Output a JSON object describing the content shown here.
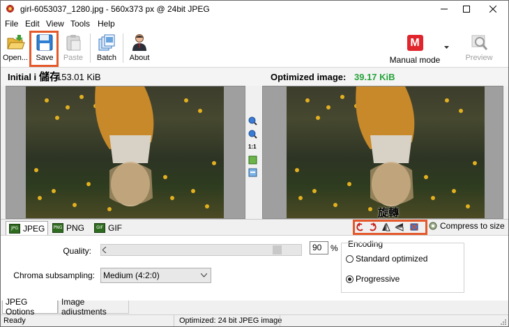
{
  "window": {
    "title": "girl-6053037_1280.jpg - 560x373 px @ 24bit JPEG"
  },
  "menu": [
    "File",
    "Edit",
    "View",
    "Tools",
    "Help"
  ],
  "toolbar": {
    "open_label": "Open...",
    "save_label": "Save",
    "paste_label": "Paste",
    "batch_label": "Batch",
    "about_label": "About",
    "mode_label": "Manual mode",
    "mode_icon_letter": "M",
    "preview_label": "Preview"
  },
  "annotations": {
    "save_cn": "儲存",
    "rotate_cn": "旋轉"
  },
  "image_header": {
    "initial_label": "Initial i",
    "initial_size": "153.01 KiB",
    "optimized_label": "Optimized image:",
    "optimized_size": "39.17 KiB"
  },
  "zoom_controls": {
    "one_to_one": "1:1"
  },
  "format_tabs": [
    {
      "label": "JPEG",
      "icon": "JPG"
    },
    {
      "label": "PNG",
      "icon": "PNG"
    },
    {
      "label": "GIF",
      "icon": "GIF"
    }
  ],
  "compress_label": "Compress to size",
  "options": {
    "quality_label": "Quality:",
    "quality_value": "90",
    "quality_unit": "%",
    "quality_level": 0.9,
    "chroma_label": "Chroma subsampling:",
    "chroma_value": "Medium (4:2:0)",
    "encoding_title": "Encoding",
    "encoding_options": [
      "Standard optimized",
      "Progressive"
    ],
    "encoding_selected": "Progressive"
  },
  "bottom_tabs": [
    "JPEG Options",
    "Image adjustments"
  ],
  "status": {
    "left": "Ready",
    "center": "Optimized: 24 bit JPEG image"
  },
  "colors": {
    "accent_highlight": "#e4582a",
    "size_green": "#27a33b",
    "mode_red": "#e0262c"
  }
}
